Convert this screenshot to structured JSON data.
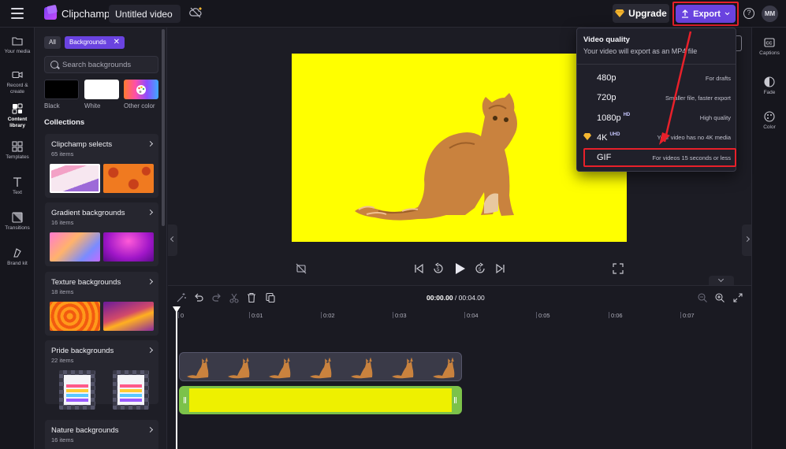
{
  "topbar": {
    "app_name": "Clipchamp",
    "video_title": "Untitled video",
    "upgrade_label": "Upgrade",
    "export_label": "Export",
    "avatar_initials": "MM",
    "help_glyph": "?"
  },
  "leftnav": {
    "items": [
      {
        "label": "Your media",
        "icon": "folder-icon"
      },
      {
        "label": "Record & create",
        "icon": "camera-icon"
      },
      {
        "label": "Content library",
        "icon": "library-icon",
        "active": true
      },
      {
        "label": "Templates",
        "icon": "templates-icon"
      },
      {
        "label": "Text",
        "icon": "text-icon"
      },
      {
        "label": "Transitions",
        "icon": "transitions-icon"
      },
      {
        "label": "Brand kit",
        "icon": "brand-kit-icon"
      }
    ]
  },
  "library": {
    "chip_all": "All",
    "chip_backgrounds": "Backgrounds",
    "chip_close": "✕",
    "search_placeholder": "Search backgrounds",
    "swatches": [
      {
        "label": "Black",
        "color": "#000000"
      },
      {
        "label": "White",
        "color": "#ffffff"
      },
      {
        "label": "Other color",
        "color": "#b14dff"
      }
    ],
    "collections_title": "Collections",
    "collections": [
      {
        "title": "Clipchamp selects",
        "count": "65 items"
      },
      {
        "title": "Gradient backgrounds",
        "count": "16 items"
      },
      {
        "title": "Texture backgrounds",
        "count": "18 items"
      },
      {
        "title": "Pride backgrounds",
        "count": "22 items"
      },
      {
        "title": "Nature backgrounds",
        "count": "16 items"
      }
    ]
  },
  "rightpanel": {
    "items": [
      {
        "label": "Captions",
        "icon": "captions-icon"
      },
      {
        "label": "Fade",
        "icon": "fade-icon"
      },
      {
        "label": "Color",
        "icon": "color-icon"
      }
    ]
  },
  "timeline": {
    "current_time": "00:00.00",
    "separator": " / ",
    "total_time": "00:04.00",
    "ruler": [
      "0",
      "0:01",
      "0:02",
      "0:03",
      "0:04",
      "0:05",
      "0:06",
      "0:07"
    ]
  },
  "export_menu": {
    "title": "Video quality",
    "subtitle": "Your video will export as an MP4 file",
    "options": [
      {
        "label": "480p",
        "badge": "",
        "desc": "For drafts"
      },
      {
        "label": "720p",
        "badge": "",
        "desc": "Smaller file, faster export"
      },
      {
        "label": "1080p",
        "badge": "HD",
        "desc": "High quality"
      },
      {
        "label": "4K",
        "badge": "UHD",
        "desc": "Your video has no 4K media",
        "premium": true
      },
      {
        "label": "GIF",
        "badge": "",
        "desc": "For videos 15 seconds or less"
      }
    ]
  },
  "colors": {
    "accent": "#6a43e0",
    "highlight": "#e8202a",
    "canvas": "#ffff00",
    "clip_border": "#7cc24a"
  }
}
